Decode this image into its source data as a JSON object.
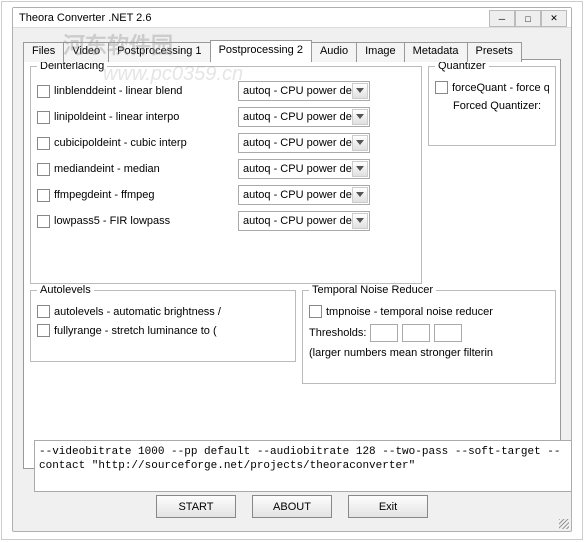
{
  "window": {
    "title": "Theora Converter .NET 2.6"
  },
  "watermark": {
    "line1": "河东软件园",
    "line2": "www.pc0359.cn"
  },
  "tabs": [
    "Files",
    "Video",
    "Postprocessing 1",
    "Postprocessing 2",
    "Audio",
    "Image",
    "Metadata",
    "Presets"
  ],
  "deinterlacing": {
    "title": "Deinterlacing",
    "items": [
      {
        "label": "linblenddeint - linear blend",
        "combo": "autoq - CPU power de"
      },
      {
        "label": "linipoldeint - linear interpo",
        "combo": "autoq - CPU power de"
      },
      {
        "label": "cubicipoldeint - cubic interp",
        "combo": "autoq - CPU power de"
      },
      {
        "label": "mediandeint - median",
        "combo": "autoq - CPU power de"
      },
      {
        "label": "ffmpegdeint - ffmpeg",
        "combo": "autoq - CPU power de"
      },
      {
        "label": "lowpass5 - FIR lowpass",
        "combo": "autoq - CPU power de"
      }
    ]
  },
  "quantizer": {
    "title": "Quantizer",
    "item": {
      "label": "forceQuant - force quan"
    },
    "forced_label": "Forced Quantizer:"
  },
  "autolevels": {
    "title": "Autolevels",
    "items": [
      "autolevels - automatic brightness /",
      "fullyrange - stretch luminance to ("
    ]
  },
  "tnr": {
    "title": "Temporal Noise Reducer",
    "item": "tmpnoise - temporal noise reducer",
    "thresholds_label": "Thresholds:",
    "note": "(larger numbers mean stronger filterin"
  },
  "cmdline": " --videobitrate 1000 --pp default --audiobitrate 128 --two-pass --soft-target --contact \"http://sourceforge.net/projects/theoraconverter\"",
  "buttons": {
    "start": "START",
    "about": "ABOUT",
    "exit": "Exit"
  }
}
